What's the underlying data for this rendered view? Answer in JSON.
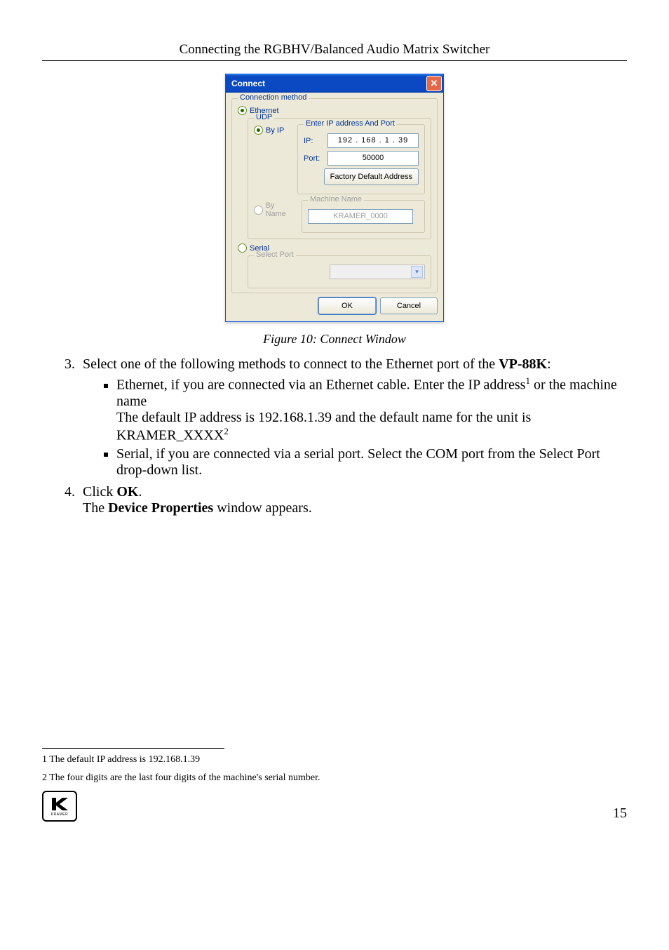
{
  "running_head": "Connecting the RGBHV/Balanced Audio Matrix Switcher",
  "dialog": {
    "title": "Connect",
    "conn_method_legend": "Connection method",
    "ethernet_label": "Ethernet",
    "udp_legend": "UDP",
    "by_ip_label": "By IP",
    "ip_group_legend": "Enter IP address And Port",
    "ip_label": "IP:",
    "ip_value": "192 . 168 .   1   . 39",
    "port_label": "Port:",
    "port_value": "50000",
    "factory_btn": "Factory Default Address",
    "by_name_label": "By Name",
    "machine_name_legend": "Machine Name",
    "machine_name_value": "KRAMER_0000",
    "serial_label": "Serial",
    "select_port_legend": "Select Port",
    "ok_btn": "OK",
    "cancel_btn": "Cancel"
  },
  "caption": "Figure 10: Connect Window",
  "step3_intro_a": "Select one of the following methods to connect to the Ethernet port of the ",
  "step3_intro_b": "VP-88K",
  "step3_intro_c": ":",
  "bullet1_a": "Ethernet, if you are connected via an Ethernet cable. Enter the IP address",
  "bullet1_b": " or the machine name",
  "bullet1_c": "The default IP address is 192.168.1.39 and the default name for the unit is KRAMER_XXXX",
  "bullet2": "Serial, if you are connected via a serial port. Select the COM port from the Select Port drop-down list.",
  "step4_a": "Click ",
  "step4_b": "OK",
  "step4_c": ".",
  "step4_line2_a": "The ",
  "step4_line2_b": "Device Properties",
  "step4_line2_c": " window appears.",
  "fn1": "1 The default IP address is 192.168.1.39",
  "fn2": "2 The four digits are the last four digits of the machine's serial number.",
  "sup1": "1",
  "sup2": "2",
  "logo_brand": "KRAMER",
  "page_num": "15"
}
